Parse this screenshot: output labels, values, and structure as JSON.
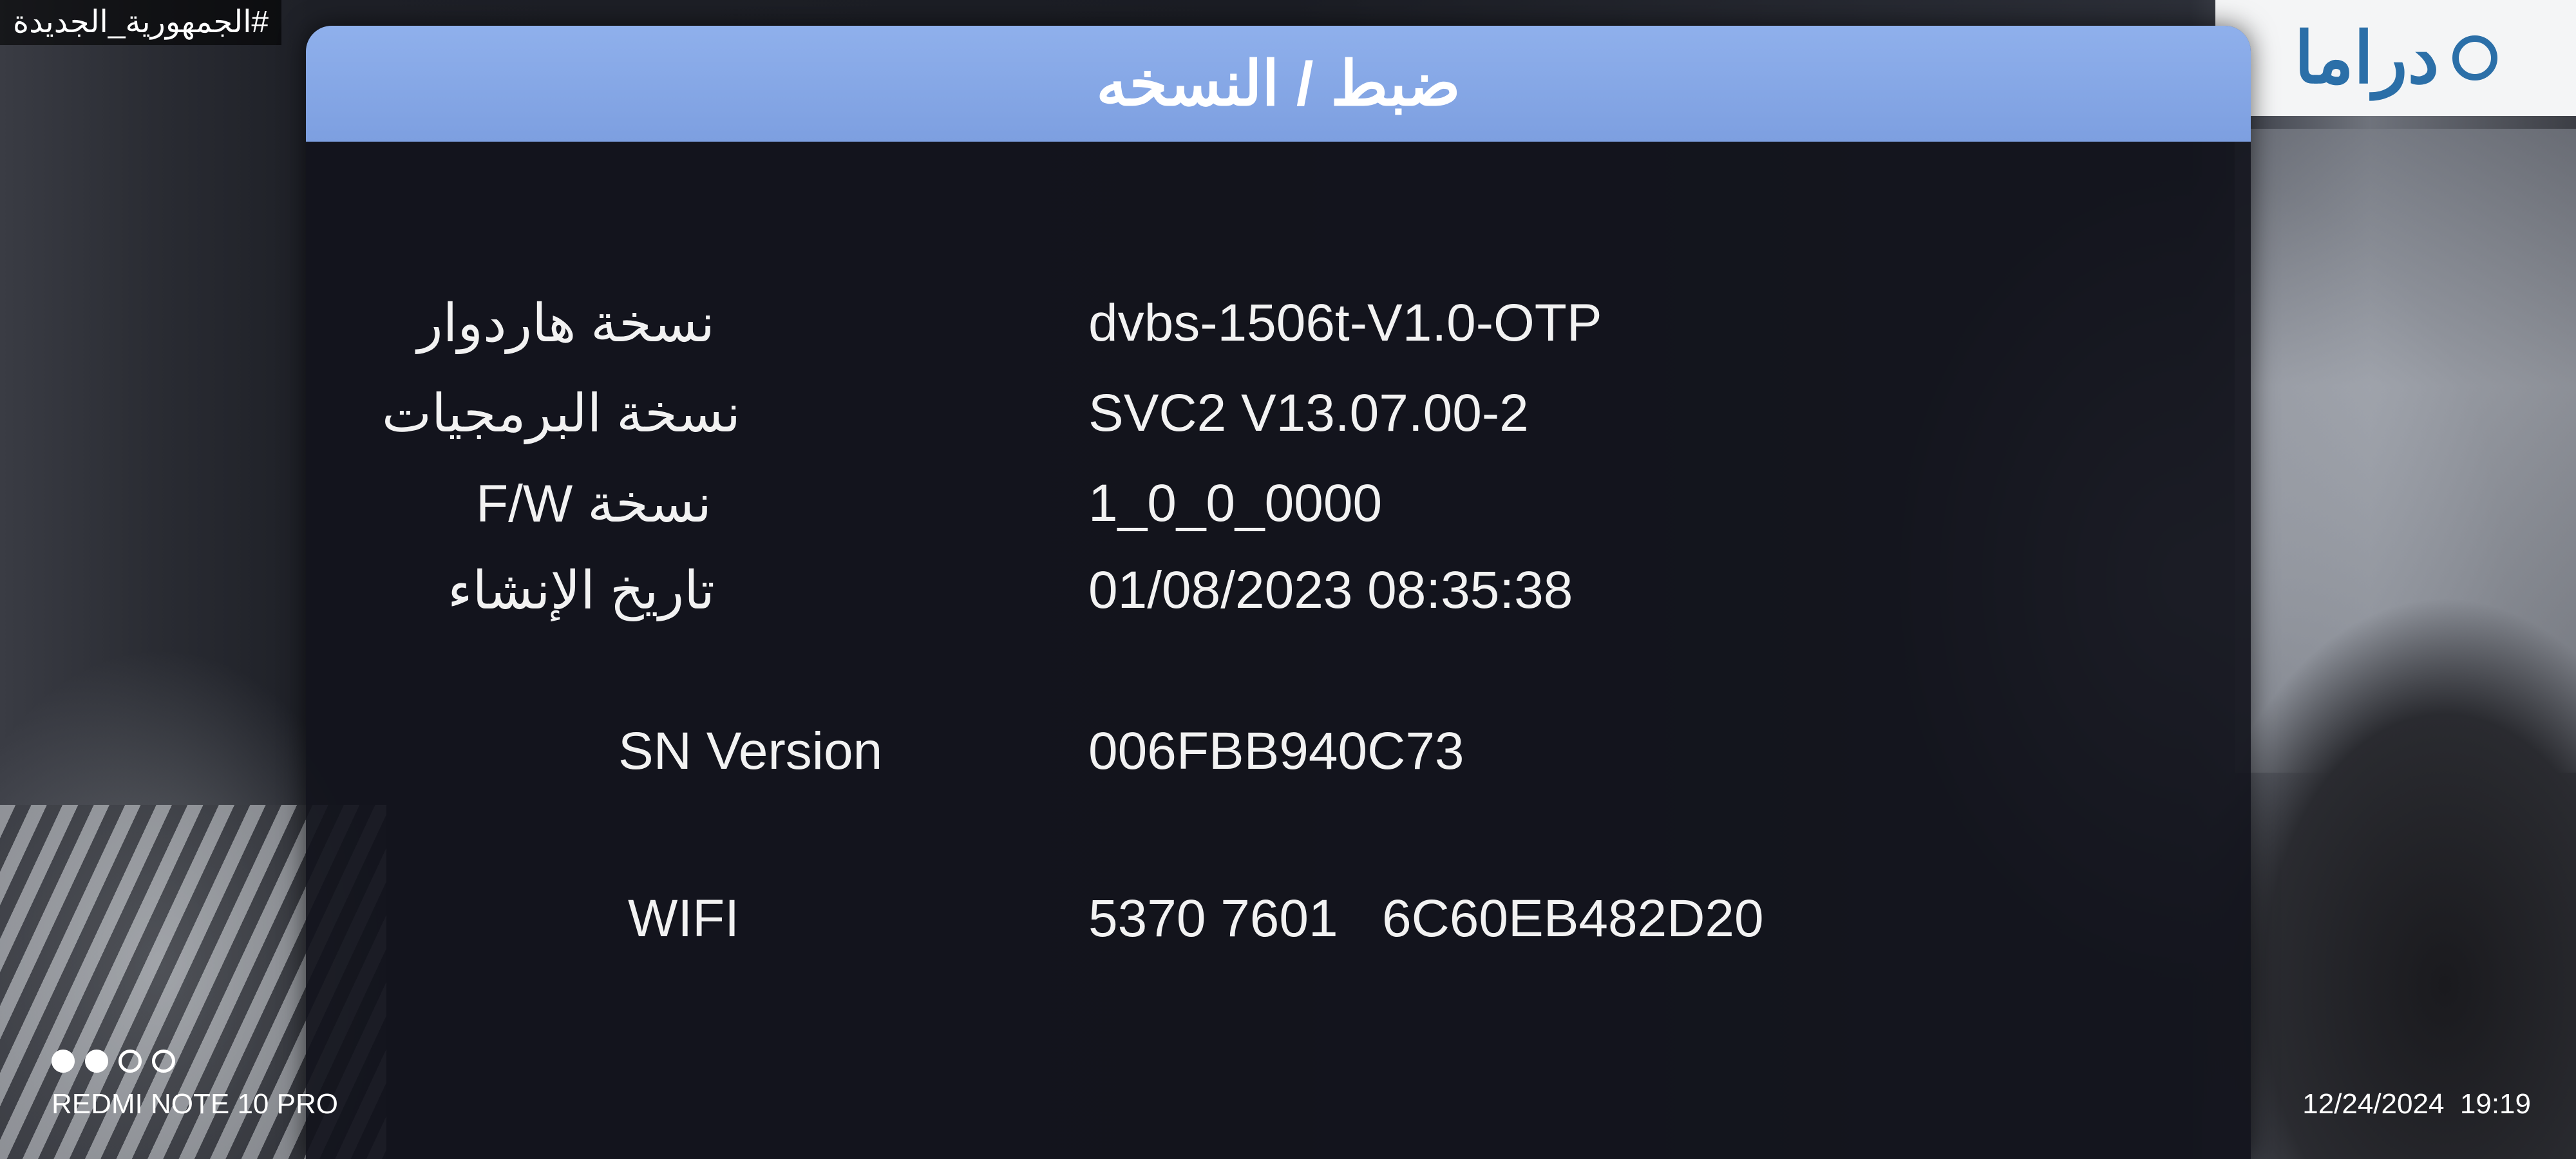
{
  "background": {
    "hashtag": "#الجمهورية_الجديدة",
    "channel_logo": "دراما",
    "logo_icon": "channel-mark-icon"
  },
  "dialog": {
    "title": "ضبط / النسخه",
    "rows": [
      {
        "label": "نسخة هاردوار",
        "value": "dvbs-1506t-V1.0-OTP"
      },
      {
        "label": "نسخة البرمجيات",
        "value": "SVC2 V13.07.00-2"
      },
      {
        "label": "نسخة F/W",
        "value": "1_0_0_0000"
      },
      {
        "label": "تاريخ الإنشاء",
        "value": "01/08/2023 08:35:38"
      },
      {
        "label": "SN Version",
        "value": "006FBB940C73"
      },
      {
        "label": "WIFI",
        "value": "5370 7601   6C60EB482D20"
      }
    ]
  },
  "watermark": {
    "device": "REDMI NOTE 10 PRO",
    "datetime": "12/24/2024  19:19"
  },
  "colors": {
    "header": "#8fb0ec",
    "panel": "#12141c",
    "text": "#f2f2f2"
  }
}
